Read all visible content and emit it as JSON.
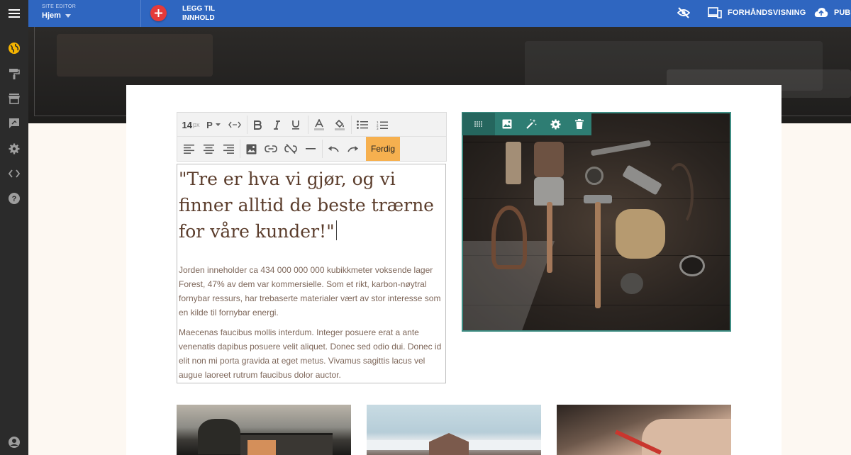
{
  "topbar": {
    "site_label": "SITE EDITOR",
    "page": "Hjem",
    "add_content": "LEGG TIL INNHOLD",
    "preview": "FORHÅNDSVISNING",
    "publish": "PUBLI"
  },
  "sidebar": {
    "items": [
      "globe-icon",
      "paint-roller-icon",
      "store-icon",
      "comment-icon",
      "gear-icon",
      "code-icon",
      "help-icon",
      "account-icon"
    ]
  },
  "editor_toolbar": {
    "font_size": "14",
    "font_unit": "px",
    "paragraph_format": "P",
    "done_label": "Ferdig"
  },
  "content": {
    "quote": "\"Tre er hva vi gjør, og vi finner alltid de beste trærne for våre kunder!\"",
    "paragraph_1": "Jorden inneholder ca 434 000 000 000 kubikkmeter voksende lager Forest, 47% av dem var kommersielle. Som et rikt, karbon-nøytral fornybar ressurs, har trebaserte materialer vært av stor interesse som en kilde til fornybar energi.",
    "paragraph_2": "Maecenas faucibus mollis interdum. Integer posuere erat a ante venenatis dapibus posuere velit aliquet. Donec sed odio dui. Donec id elit non mi porta gravida at eget metus. Vivamus sagittis lacus vel augue laoreet rutrum faucibus dolor auctor."
  },
  "colors": {
    "topbar": "#2f66c0",
    "rail": "#2b2b2b",
    "accent_teal": "#2e7d73",
    "done_button": "#f6b04f",
    "add_button": "#e53a3a",
    "quote_text": "#5b3d2c"
  }
}
